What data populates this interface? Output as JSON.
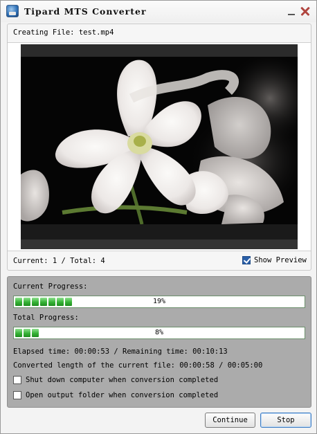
{
  "window": {
    "title": "Tipard MTS Converter"
  },
  "preview": {
    "creating_file": "Creating File: test.mp4",
    "counter": "Current: 1 / Total: 4",
    "show_preview_label": "Show Preview",
    "show_preview_checked": true
  },
  "progress": {
    "current_label": "Current Progress:",
    "current_value": 0.19,
    "current_text": "19%",
    "total_label": "Total Progress:",
    "total_value": 0.08,
    "total_text": "8%",
    "elapsed_text": "Elapsed time: 00:00:53 / Remaining time: 00:10:13",
    "converted_text": "Converted length of the current file: 00:00:58 / 00:05:00",
    "option_shutdown": "Shut down computer when conversion completed",
    "option_shutdown_checked": false,
    "option_open_folder": "Open output folder when conversion completed",
    "option_open_folder_checked": false
  },
  "buttons": {
    "continue_label": "Continue",
    "stop_label": "Stop"
  },
  "colors": {
    "accent": "#2a5fa8",
    "progress_green": "#36b236",
    "panel_gray": "#ababab"
  }
}
